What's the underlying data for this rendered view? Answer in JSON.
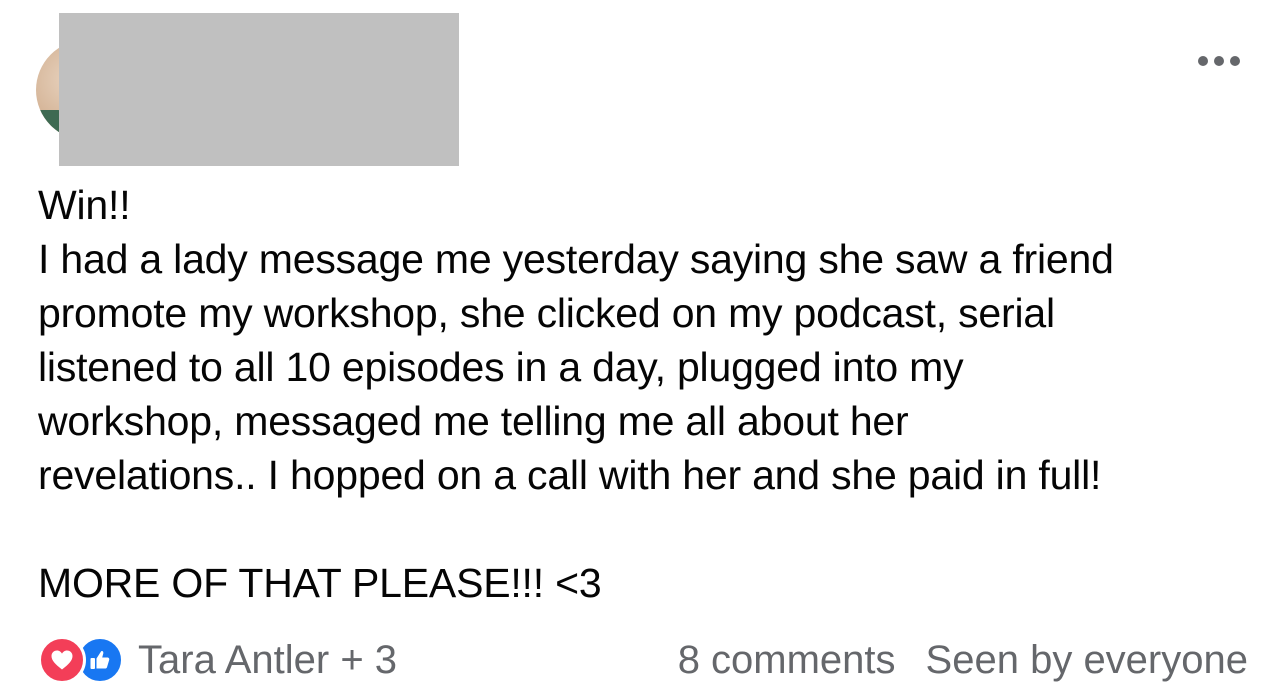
{
  "post": {
    "text_lines": {
      "heading": "Win!!",
      "body": "I had a lady message me yesterday saying she saw a friend\npromote my workshop, she clicked on my podcast, serial\nlistened to all 10 episodes in a day, plugged into my\nworkshop, messaged me telling me all about her\nrevelations.. I hopped on a call with her and she paid in full!",
      "closing": "MORE OF THAT PLEASE!!! <3"
    },
    "icons": {
      "menu": "more-horizontal-icon",
      "love": "heart-icon",
      "like": "thumbs-up-icon"
    },
    "footer": {
      "reaction_names": "Tara Antler + 3",
      "comments_count": "8 comments",
      "seen_status": "Seen by everyone"
    },
    "colors": {
      "love": "#f33e58",
      "like": "#1877f2",
      "secondary_text": "#65676b",
      "redaction": "#c0c0c0"
    }
  }
}
